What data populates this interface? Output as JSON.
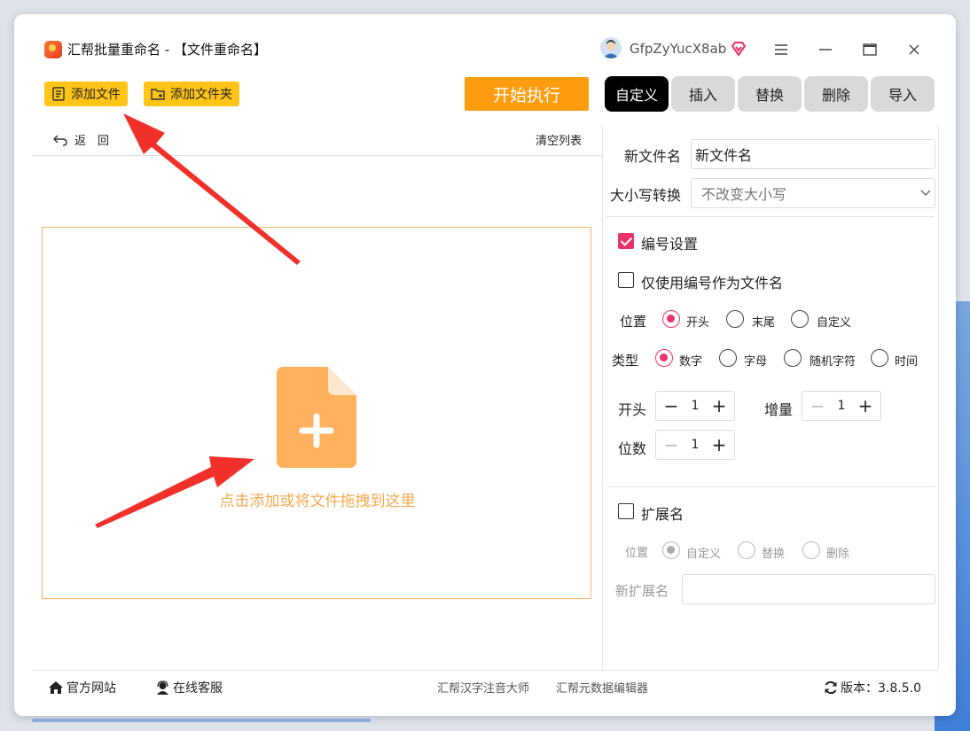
{
  "window": {
    "title": "汇帮批量重命名 - 【文件重命名】",
    "username": "GfpZyYucX8ab",
    "controls": [
      "≡",
      "—",
      "□",
      "✕"
    ]
  },
  "toolbar": {
    "add_file": "添加文件",
    "add_folder": "添加文件夹",
    "start": "开始执行",
    "back": "返　回",
    "clear_list": "清空列表"
  },
  "dropzone": {
    "hint": "点击添加或将文件拖拽到这里"
  },
  "tabs": [
    {
      "label": "自定义",
      "active": true
    },
    {
      "label": "插入",
      "active": false
    },
    {
      "label": "替换",
      "active": false
    },
    {
      "label": "删除",
      "active": false
    },
    {
      "label": "导入",
      "active": false
    }
  ],
  "form": {
    "new_name_label": "新文件名",
    "new_name_value": "新文件名",
    "case_label": "大小写转换",
    "case_value": "不改变大小写",
    "numbering_label": "编号设置",
    "numbering_checked": true,
    "only_number_label": "仅使用编号作为文件名",
    "only_number_checked": false,
    "position_label": "位置",
    "position_options": [
      "开头",
      "末尾",
      "自定义"
    ],
    "position_selected": "开头",
    "type_label": "类型",
    "type_options": [
      "数字",
      "字母",
      "随机字符",
      "时间"
    ],
    "type_selected": "数字",
    "start_label": "开头",
    "start_value": "1",
    "increment_label": "增量",
    "increment_value": "1",
    "digits_label": "位数",
    "digits_value": "1",
    "ext_label": "扩展名",
    "ext_checked": false,
    "ext_position_label": "位置",
    "ext_position_options": [
      "自定义",
      "替换",
      "删除"
    ],
    "ext_position_selected": "自定义",
    "new_ext_label": "新扩展名",
    "new_ext_value": ""
  },
  "footer": {
    "website": "官方网站",
    "support": "在线客服",
    "link1": "汇帮汉字注音大师",
    "link2": "汇帮元数据编辑器",
    "version": "版本：3.8.5.0"
  },
  "colors": {
    "accent": "#e8326a",
    "button_yellow": "#ffc418",
    "start_orange": "#ff9c0f",
    "dropzone_orange": "#f6a94f",
    "arrow_red": "#f2302a"
  }
}
